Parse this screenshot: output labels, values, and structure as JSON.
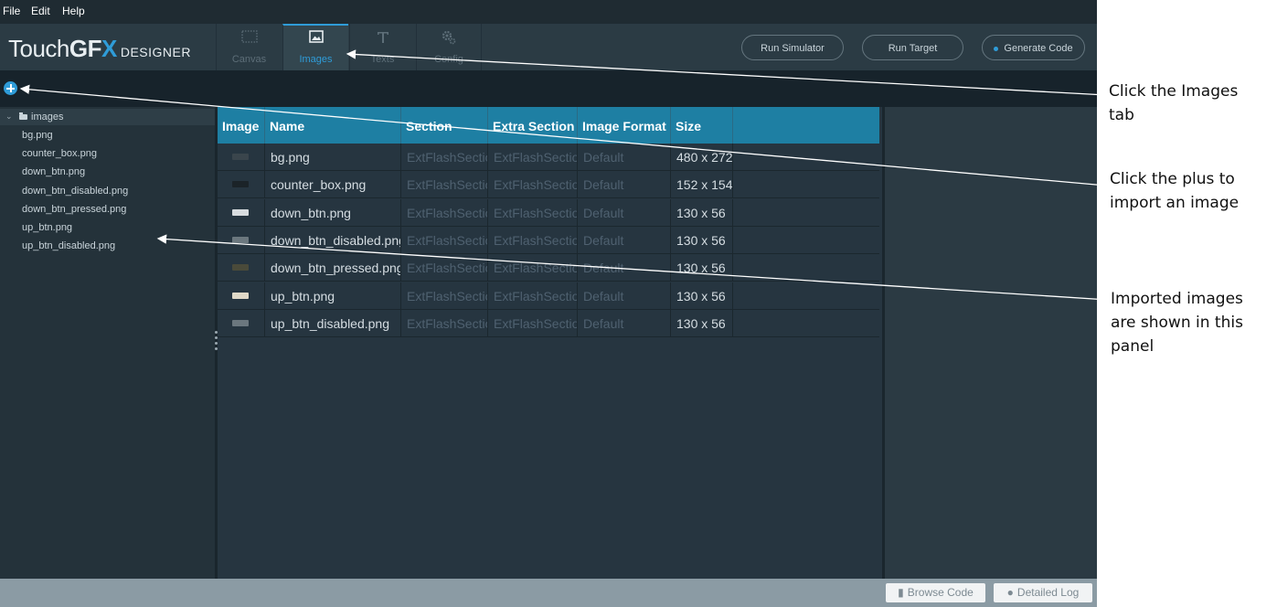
{
  "menu": {
    "file": "File",
    "edit": "Edit",
    "help": "Help"
  },
  "logo": {
    "touch": "Touch",
    "gf": "GF",
    "x": "X",
    "designer": "DESIGNER"
  },
  "tabs": [
    {
      "label": "Canvas",
      "icon": "canvas-icon"
    },
    {
      "label": "Images",
      "icon": "image-icon",
      "active": true
    },
    {
      "label": "Texts",
      "icon": "text-icon"
    },
    {
      "label": "Config",
      "icon": "gears-icon"
    }
  ],
  "header_buttons": {
    "run_simulator": "Run Simulator",
    "run_target": "Run Target",
    "generate_code": "Generate Code"
  },
  "sidebar": {
    "folder": "images",
    "files": [
      "bg.png",
      "counter_box.png",
      "down_btn.png",
      "down_btn_disabled.png",
      "down_btn_pressed.png",
      "up_btn.png",
      "up_btn_disabled.png"
    ]
  },
  "table": {
    "headers": {
      "image": "Image",
      "name": "Name",
      "section": "Section",
      "extra_section": "Extra Section",
      "image_format": "Image Format",
      "size": "Size"
    },
    "rows": [
      {
        "name": "bg.png",
        "section": "ExtFlashSection",
        "extra_section": "ExtFlashSection",
        "format": "Default",
        "size": "480 x 272",
        "thumb_color": "#3a454c"
      },
      {
        "name": "counter_box.png",
        "section": "ExtFlashSection",
        "extra_section": "ExtFlashSection",
        "format": "Default",
        "size": "152 x 154",
        "thumb_color": "#1b2328"
      },
      {
        "name": "down_btn.png",
        "section": "ExtFlashSection",
        "extra_section": "ExtFlashSection",
        "format": "Default",
        "size": "130 x 56",
        "thumb_color": "#d8dcdf"
      },
      {
        "name": "down_btn_disabled.png",
        "section": "ExtFlashSection",
        "extra_section": "ExtFlashSection",
        "format": "Default",
        "size": "130 x 56",
        "thumb_color": "#6b777e"
      },
      {
        "name": "down_btn_pressed.png",
        "section": "ExtFlashSection",
        "extra_section": "ExtFlashSection",
        "format": "Default",
        "size": "130 x 56",
        "thumb_color": "#4a4a3a"
      },
      {
        "name": "up_btn.png",
        "section": "ExtFlashSection",
        "extra_section": "ExtFlashSection",
        "format": "Default",
        "size": "130 x 56",
        "thumb_color": "#e0d9c8"
      },
      {
        "name": "up_btn_disabled.png",
        "section": "ExtFlashSection",
        "extra_section": "ExtFlashSection",
        "format": "Default",
        "size": "130 x 56",
        "thumb_color": "#6b777e"
      }
    ]
  },
  "footer": {
    "browse_code": "Browse Code",
    "detailed_log": "Detailed Log"
  },
  "annotations": {
    "images_tab": "Click the Images\ntab",
    "plus": "Click the plus to\nimport an image",
    "panel": "Imported images\nare shown in this\npanel"
  },
  "colors": {
    "accent": "#2f9cd8",
    "table_header": "#1e7fa3",
    "background": "#2b3a43"
  }
}
